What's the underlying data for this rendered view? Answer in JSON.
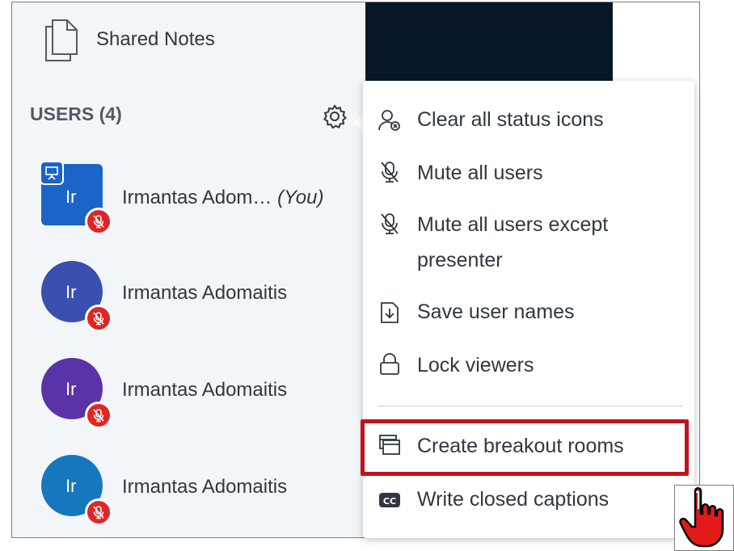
{
  "sidebar": {
    "shared_notes_label": "Shared Notes",
    "users_title": "USERS (4)",
    "users": [
      {
        "initials": "Ir",
        "name": "Irmantas Adom…",
        "you_label": "(You)",
        "avatar_color": "#1b64c8",
        "shape": "square",
        "presenter": true,
        "muted": true
      },
      {
        "initials": "Ir",
        "name": "Irmantas Adomaitis",
        "you_label": "",
        "avatar_color": "#3a4fb0",
        "shape": "round",
        "presenter": false,
        "muted": true
      },
      {
        "initials": "Ir",
        "name": "Irmantas Adomaitis",
        "you_label": "",
        "avatar_color": "#5a33a8",
        "shape": "round",
        "presenter": false,
        "muted": true
      },
      {
        "initials": "Ir",
        "name": "Irmantas Adomaitis",
        "you_label": "",
        "avatar_color": "#1677bf",
        "shape": "round",
        "presenter": false,
        "muted": true
      }
    ]
  },
  "menu": {
    "items": [
      {
        "label": "Clear all status icons",
        "icon": "clear-status-icon"
      },
      {
        "label": "Mute all users",
        "icon": "mic-off-icon"
      },
      {
        "label": "Mute all users except",
        "label2": "presenter",
        "icon": "mic-off-icon"
      },
      {
        "label": "Save user names",
        "icon": "download-file-icon"
      },
      {
        "label": "Lock viewers",
        "icon": "lock-icon"
      },
      {
        "label": "Create breakout rooms",
        "icon": "breakout-rooms-icon"
      },
      {
        "label": "Write closed captions",
        "icon": "closed-captions-icon"
      }
    ]
  },
  "colors": {
    "sidebar_bg": "#f3f6f9",
    "panel_dark": "#06172a",
    "mute_red": "#e32424",
    "highlight_red": "#c0141c"
  }
}
